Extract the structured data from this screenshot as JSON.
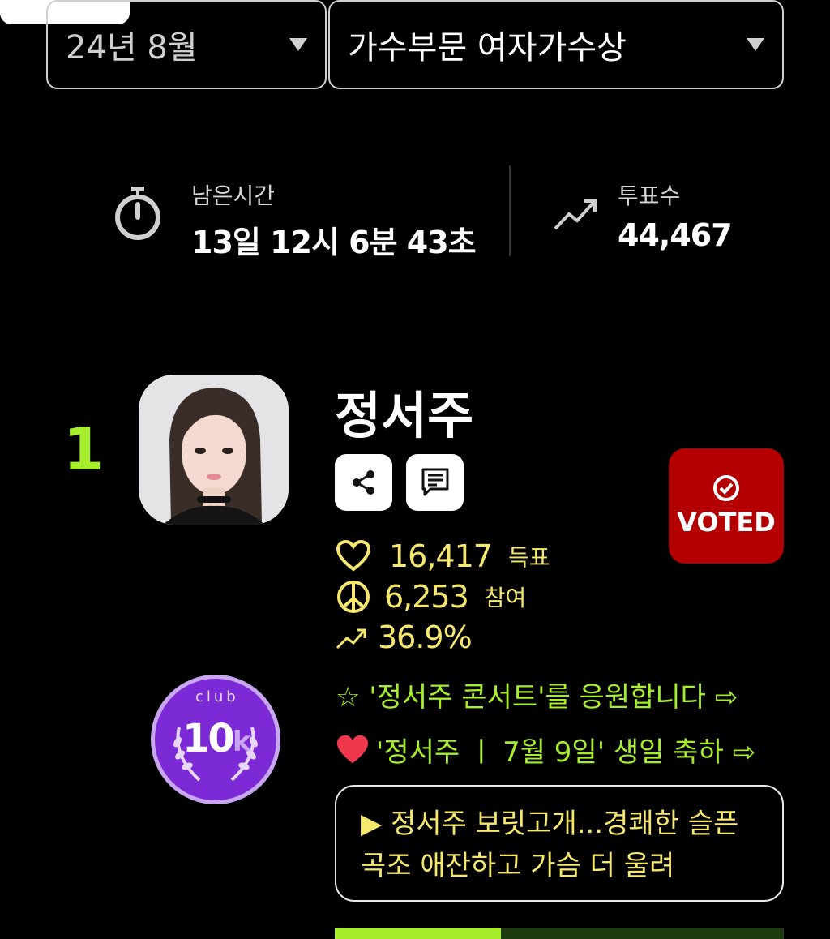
{
  "filters": {
    "period": "24년 8월",
    "category": "가수부문 여자가수상"
  },
  "stats": {
    "time_left_label": "남은시간",
    "time_left_value": "13일 12시 6분 43초",
    "votes_label": "투표수",
    "votes_value": "44,467"
  },
  "candidate": {
    "rank": "1",
    "name": "정서주",
    "voted_label": "VOTED",
    "votes": "16,417",
    "votes_unit": "득표",
    "participants": "6,253",
    "participants_unit": "참여",
    "percent": "36.9%",
    "badge_top": "club",
    "badge_main": "10",
    "badge_suffix": "k",
    "cheer_1": "☆ '정서주 콘서트'를 응원합니다 ⇨",
    "cheer_2": "'정서주 ㅣ 7월 9일' 생일 축하 ⇨",
    "news": "▶ 정서주 보릿고개...경쾌한 슬픈 곡조 애잔하고 가슴 더 울려",
    "progress": 0.37
  },
  "colors": {
    "accent_green": "#a6ee2b",
    "accent_yellow": "#f5e86c",
    "voted_red": "#b40000",
    "badge_purple": "#7b2ad6"
  },
  "icons": [
    "chevron-down-icon",
    "stopwatch-icon",
    "trend-up-icon",
    "share-icon",
    "comment-icon",
    "check-circle-icon",
    "heart-icon",
    "peace-icon",
    "heart-emoji-icon",
    "laurel-icon"
  ]
}
